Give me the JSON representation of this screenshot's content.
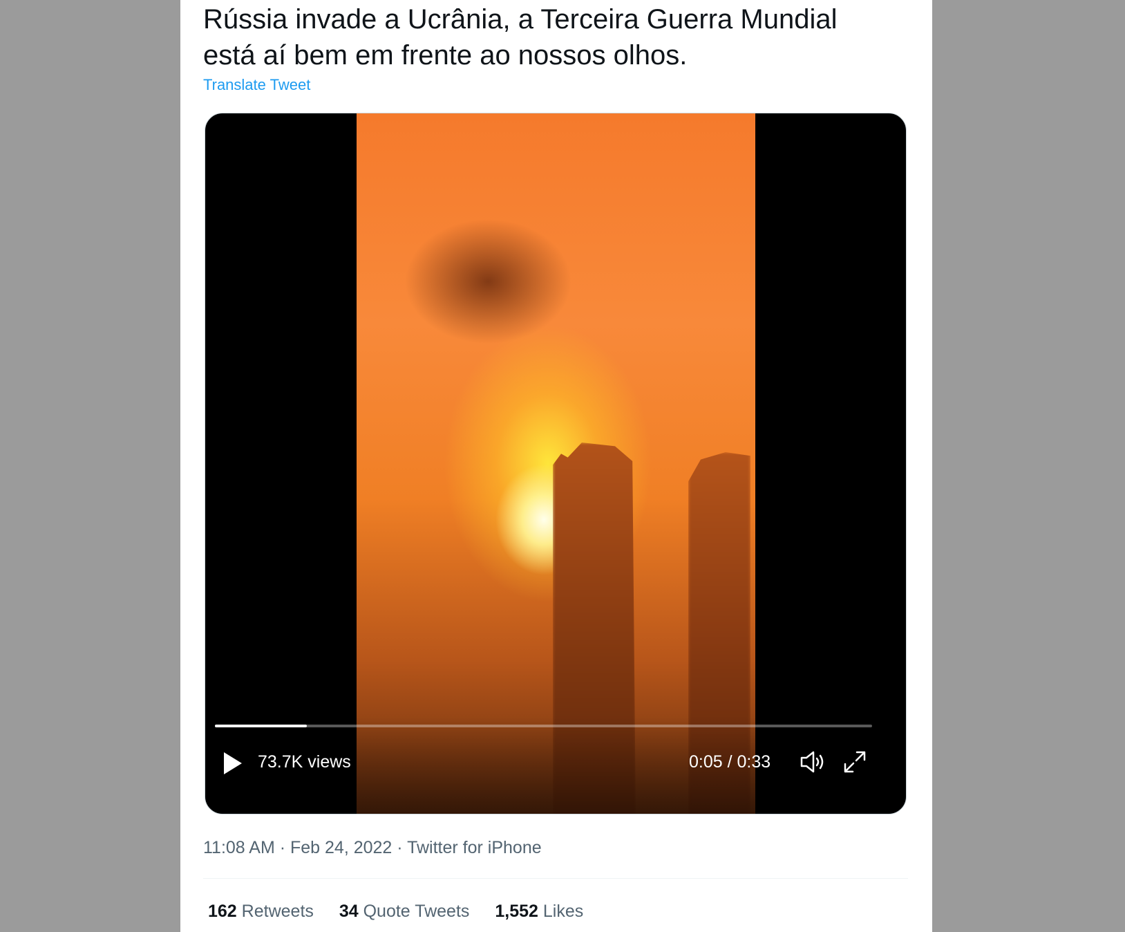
{
  "tweet": {
    "text_line1": "Rússia invade a Ucrânia, a Terceira Guerra Mundial",
    "text_line2": "está aí bem em frente ao nossos olhos.",
    "translate_label": "Translate Tweet"
  },
  "video": {
    "views": "73.7K views",
    "time": "0:05 / 0:33",
    "progress": 0.14,
    "icons": [
      "play-icon",
      "volume-icon",
      "fullscreen-icon"
    ]
  },
  "meta": {
    "time": "11:08 AM",
    "separator1": " · ",
    "date": "Feb 24, 2022",
    "separator2": " · ",
    "source": "Twitter for iPhone"
  },
  "stats": {
    "retweets_count": "162",
    "retweets_label": "Retweets",
    "quotes_count": "34",
    "quotes_label": "Quote Tweets",
    "likes_count": "1,552",
    "likes_label": "Likes"
  },
  "colors": {
    "link": "#1d9bf0",
    "text": "#0f1419",
    "secondary": "#536471",
    "backdrop": "#9b9b9b"
  }
}
